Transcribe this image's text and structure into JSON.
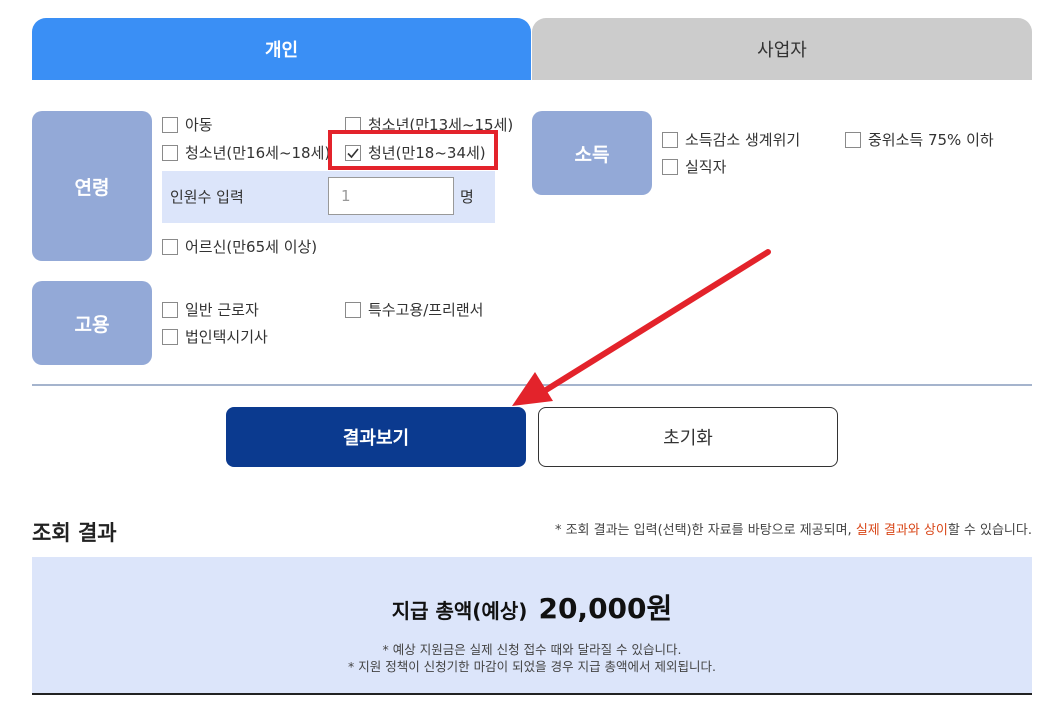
{
  "tabs": [
    {
      "label": "개인",
      "active": true
    },
    {
      "label": "사업자",
      "active": false
    }
  ],
  "categories": {
    "age": "연령",
    "employment": "고용",
    "income": "소득"
  },
  "age_options": [
    {
      "label": "아동",
      "checked": false
    },
    {
      "label": "청소년(만13세~15세)",
      "checked": false
    },
    {
      "label": "청소년(만16세~18세)",
      "checked": false
    },
    {
      "label": "청년(만18~34세)",
      "checked": true
    },
    {
      "label": "어르신(만65세 이상)",
      "checked": false
    }
  ],
  "headcount": {
    "label": "인원수 입력",
    "value": "1",
    "unit": "명"
  },
  "employment_options": [
    {
      "label": "일반 근로자",
      "checked": false
    },
    {
      "label": "특수고용/프리랜서",
      "checked": false
    },
    {
      "label": "법인택시기사",
      "checked": false
    }
  ],
  "income_options": [
    {
      "label": "소득감소 생계위기",
      "checked": false
    },
    {
      "label": "중위소득 75% 이하",
      "checked": false
    },
    {
      "label": "실직자",
      "checked": false
    }
  ],
  "buttons": {
    "view_results": "결과보기",
    "reset": "초기화"
  },
  "result": {
    "title": "조회 결과",
    "note_prefix": "* 조회 결과는 입력(선택)한 자료를 바탕으로 제공되며, ",
    "note_highlight": "실제 결과와 상이",
    "note_suffix": "할 수 있습니다.",
    "total_label": "지급 총액(예상)",
    "total_amount": "20,000원",
    "sub_note_1": "* 예상 지원금은 실제 신청 접수 때와 달라질 수 있습니다.",
    "sub_note_2": "* 지원 정책이 신청기한 마감이 되었을 경우 지급 총액에서 제외됩니다."
  },
  "colors": {
    "active_tab": "#3a8ff5",
    "category_bg": "#93a9d7",
    "primary_button": "#0b3a8f",
    "highlight_box": "#e3232b",
    "annotation_arrow": "#e3232b",
    "result_bg": "#dce5fa"
  },
  "icons": {
    "checkbox_checked": "check-icon",
    "annotation": "arrow-icon"
  }
}
